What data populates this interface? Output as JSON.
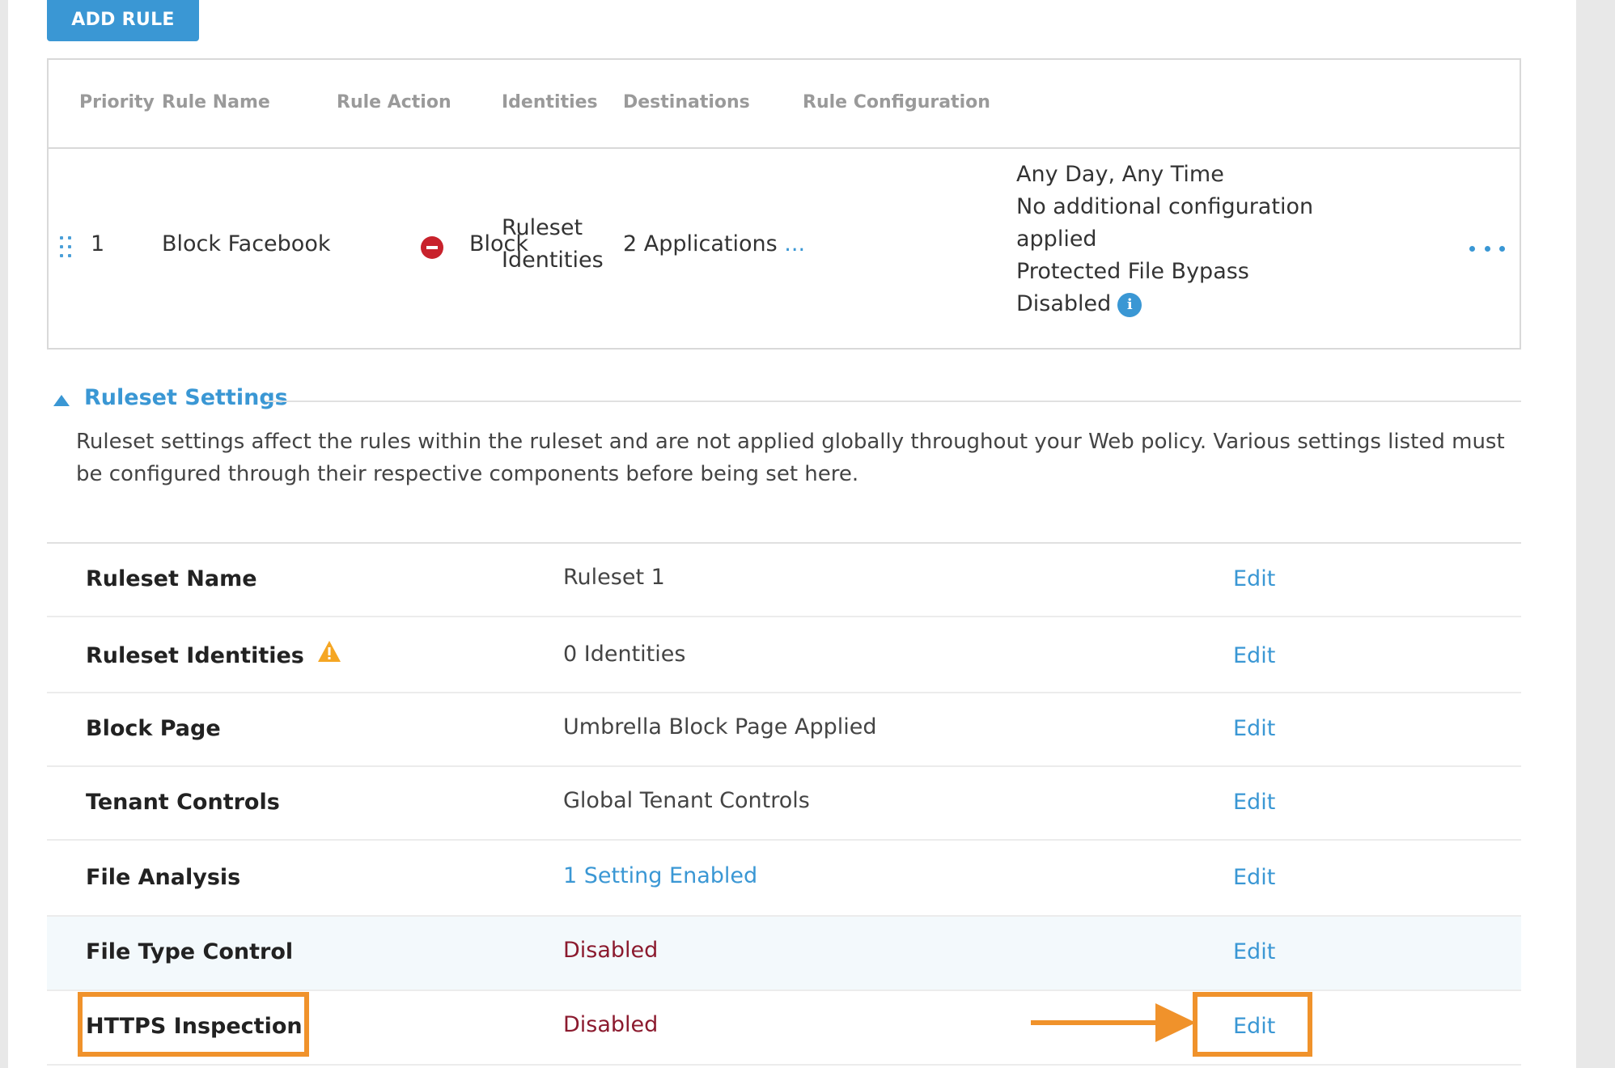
{
  "toolbar": {
    "add_rule_label": "ADD RULE"
  },
  "rules_table": {
    "headers": {
      "priority": "Priority",
      "rule_name": "Rule Name",
      "rule_action": "Rule Action",
      "identities": "Identities",
      "destinations": "Destinations",
      "rule_configuration": "Rule Configuration"
    },
    "rows": [
      {
        "priority": "1",
        "name": "Block Facebook",
        "action": "Block",
        "identities_line1": "Ruleset",
        "identities_line2": "Identities",
        "destinations": "2 Applications",
        "destinations_more": "...",
        "config_line1": "Any Day, Any Time",
        "config_line2": "No additional configuration",
        "config_line3": "applied",
        "config_line4": "Protected File Bypass",
        "config_line5": "Disabled",
        "info_glyph": "i"
      }
    ]
  },
  "ruleset_settings": {
    "title": "Ruleset Settings",
    "description": "Ruleset settings affect the rules within the ruleset and are not applied globally throughout your Web policy. Various settings listed must be configured through their respective components before being set here.",
    "edit_label": "Edit",
    "rows": [
      {
        "name": "Ruleset Name",
        "value": "Ruleset 1"
      },
      {
        "name": "Ruleset Identities",
        "value": "0 Identities"
      },
      {
        "name": "Block Page",
        "value": "Umbrella Block Page Applied"
      },
      {
        "name": "Tenant Controls",
        "value": "Global Tenant Controls"
      },
      {
        "name": "File Analysis",
        "value": "1 Setting Enabled"
      },
      {
        "name": "File Type Control",
        "value": "Disabled"
      },
      {
        "name": "HTTPS Inspection",
        "value": "Disabled"
      }
    ]
  },
  "colors": {
    "accent": "#3a97d4",
    "block": "#c8222c",
    "disabled_text": "#8b1a2e",
    "warning": "#f5a623",
    "annotation": "#f0922b"
  },
  "icons": [
    "drag-handle-icon",
    "block-icon",
    "info-icon",
    "more-options-icon",
    "caret-up-icon",
    "warning-icon",
    "arrow-right-icon"
  ]
}
